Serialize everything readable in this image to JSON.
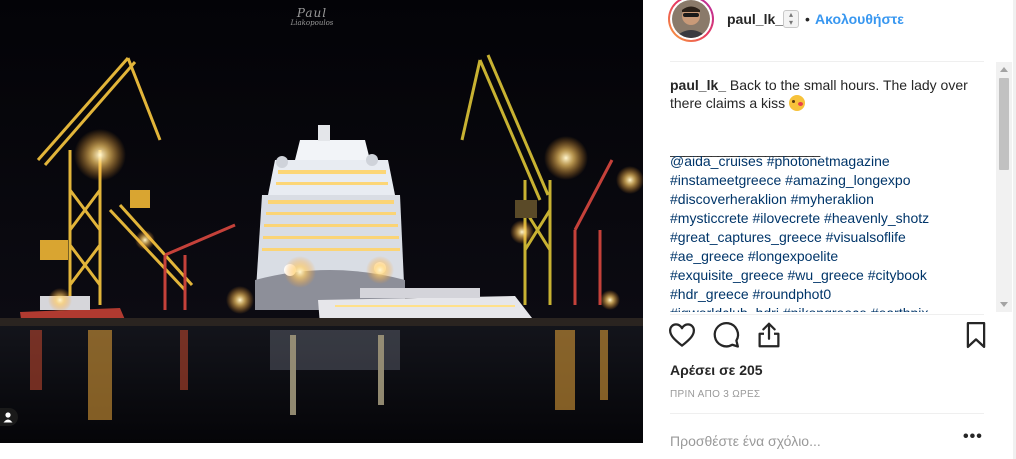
{
  "photo": {
    "watermark_line1": "Paul",
    "watermark_line2": "Liakopoulos"
  },
  "header": {
    "username": "paul_lk_",
    "separator": "•",
    "follow_label": "Ακολουθήστε"
  },
  "caption": {
    "username": "paul_lk_",
    "text": "Back to the small hours. The lady over there claims a kiss",
    "rule": "______________________",
    "hashtags": [
      "@aida_cruises #photonetmagazine",
      "#instameetgreece #amazing_longexpo",
      "#discoverheraklion #myheraklion",
      "#mysticcrete #ilovecrete #heavenly_shotz",
      "#great_captures_greece #visualsoflife",
      "#ae_greece #longexpoelite",
      "#exquisite_greece #wu_greece #citybook",
      "#hdr_greece #roundphot0",
      "#igworldclub_hdri #nikongreece #earthpix"
    ]
  },
  "icons": {
    "like": "heart-icon",
    "comment": "comment-bubble-icon",
    "share": "share-icon",
    "save": "bookmark-icon",
    "more": "ellipsis-icon",
    "tag": "user-tag-icon"
  },
  "likes": {
    "label": "Αρέσει σε 205"
  },
  "timestamp": {
    "label": "ΠΡΙΝ ΑΠΟ 3 ΩΡΕΣ"
  },
  "comment_box": {
    "placeholder": "Προσθέστε ένα σχόλιο..."
  },
  "more_label": "•••",
  "colors": {
    "follow": "#3897f0",
    "hashtag": "#003569",
    "text": "#262626",
    "muted": "#999999",
    "divider": "#efefef"
  }
}
